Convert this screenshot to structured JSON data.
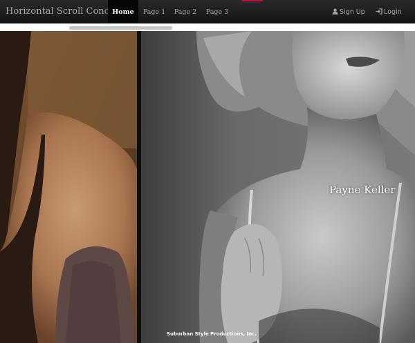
{
  "navbar": {
    "brand": "Horizontal Scroll Concepts",
    "links": [
      "Home",
      "Page 1",
      "Page 2",
      "Page 3"
    ],
    "active_link": "Home",
    "sign_up": "Sign Up",
    "login": "Login",
    "icons": {
      "sign_up": "user-icon",
      "login": "login-icon"
    }
  },
  "colors": {
    "navbar_bg": "#1b1b1b",
    "nav_text": "#a8a8a8",
    "active_bg": "#070707",
    "accent": "#c0123a"
  },
  "gallery": {
    "images": [
      "sepia-portrait-photo",
      "black-and-white-portrait-photo"
    ],
    "caption": "Payne Keller"
  },
  "footer": {
    "credit": "Suburban Style Productions, Inc."
  }
}
